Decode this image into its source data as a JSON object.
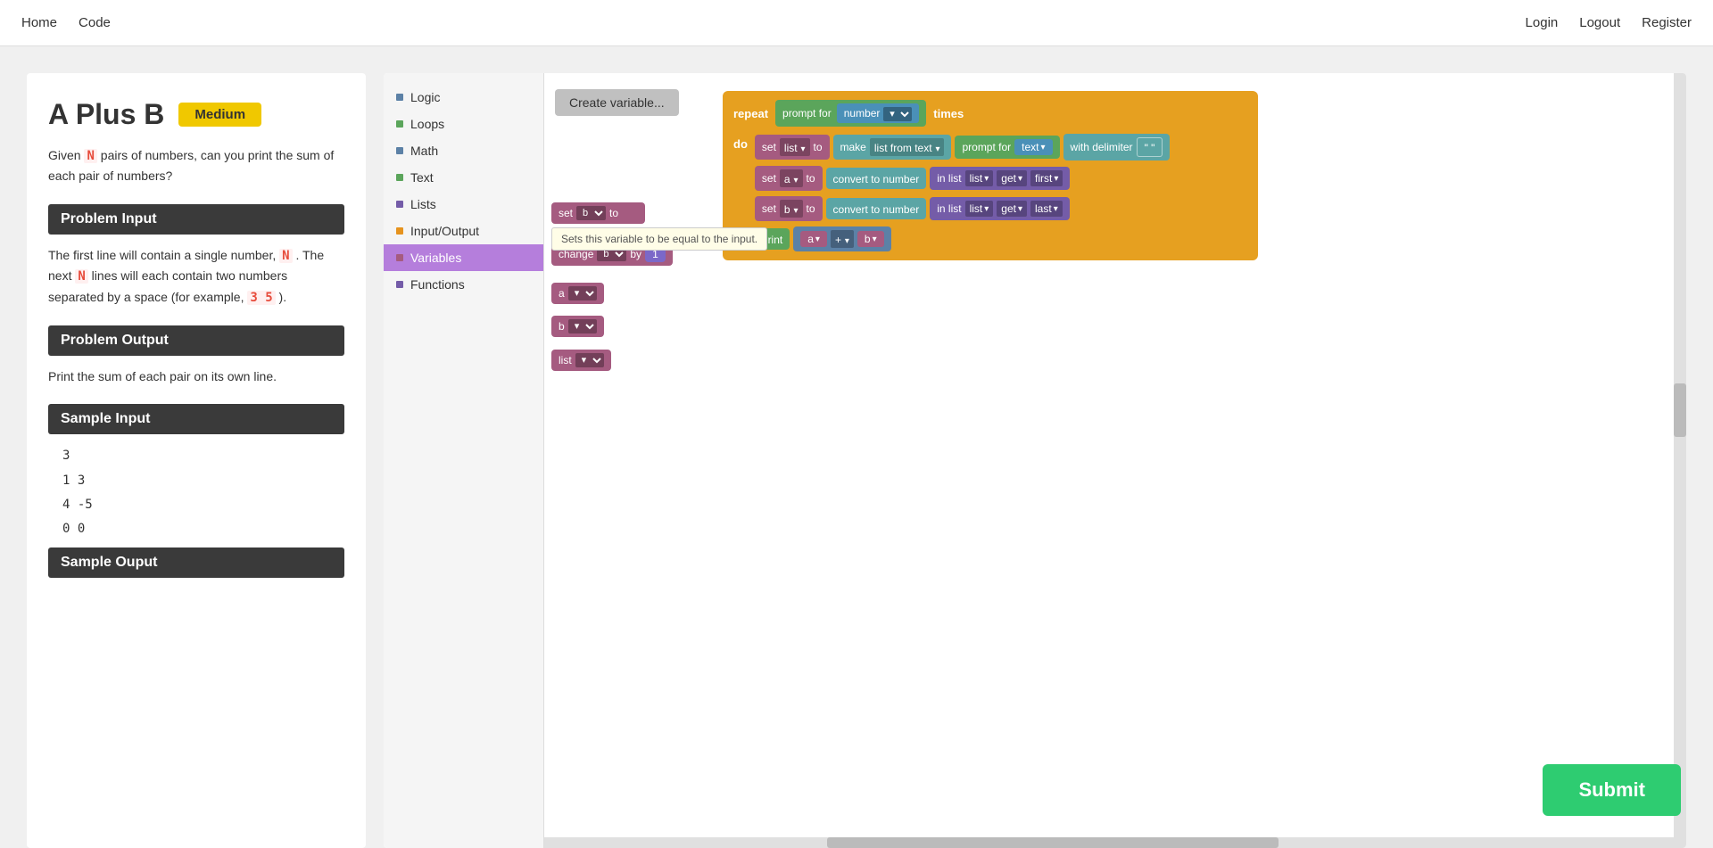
{
  "nav": {
    "home": "Home",
    "code": "Code",
    "login": "Login",
    "logout": "Logout",
    "register": "Register"
  },
  "problem": {
    "title": "A Plus B",
    "difficulty": "Medium",
    "description": "Given  N  pairs of numbers, can you print the sum of each pair of numbers?",
    "input_section": "Problem Input",
    "input_text": "The first line will contain a single number,  N . The next  N  lines will each contain two numbers separated by a space (for example,  3 5 ).",
    "output_section": "Problem Output",
    "output_text": "Print the sum of each pair on its own line.",
    "sample_input_section": "Sample Input",
    "sample_data": [
      "3",
      "1 3",
      "4 -5",
      "0 0"
    ],
    "sample_output_section": "Sample Ouput"
  },
  "toolbox": {
    "items": [
      {
        "label": "Logic",
        "dot": "logic"
      },
      {
        "label": "Loops",
        "dot": "loops"
      },
      {
        "label": "Math",
        "dot": "math"
      },
      {
        "label": "Text",
        "dot": "text"
      },
      {
        "label": "Lists",
        "dot": "lists"
      },
      {
        "label": "Input/Output",
        "dot": "inputoutput"
      },
      {
        "label": "Variables",
        "dot": "variables",
        "active": true
      },
      {
        "label": "Functions",
        "dot": "functions"
      }
    ]
  },
  "workspace": {
    "create_variable_btn": "Create variable...",
    "tooltip": "Sets this variable to be equal to the input.",
    "set_block1": {
      "label": "set",
      "var": "b",
      "to": "to"
    },
    "change_block": {
      "label": "change",
      "var": "b",
      "by": "by",
      "value": "1"
    },
    "var_a": "a",
    "var_b": "b",
    "var_list": "list",
    "repeat_block": {
      "repeat": "repeat",
      "prompt_for": "prompt for",
      "type": "number",
      "times": "times",
      "do_label": "do",
      "rows": [
        {
          "set": "set",
          "var": "list",
          "to": "to",
          "make": "make",
          "list_from_text": "list from text",
          "prompt_for": "prompt for",
          "type": "text",
          "with_delimiter": "with delimiter",
          "delimiter": "\" \""
        },
        {
          "set": "set",
          "var": "a",
          "to": "to",
          "convert": "convert to number",
          "in_list": "in list",
          "list_var": "list",
          "get": "get",
          "position": "first"
        },
        {
          "set": "set",
          "var": "b",
          "to": "to",
          "convert": "convert to number",
          "in_list": "in list",
          "list_var": "list",
          "get": "get",
          "position": "last"
        },
        {
          "print": "print",
          "var_a": "a",
          "op": "+",
          "var_b": "b"
        }
      ]
    }
  },
  "submit_btn": "Submit"
}
